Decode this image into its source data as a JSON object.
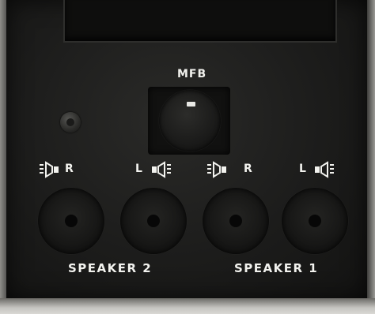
{
  "device_panel": {
    "mfb_label": "MFB",
    "speaker_groups": [
      {
        "label": "SPEAKER 2",
        "left_channel_mark": "R",
        "right_channel_mark": "L"
      },
      {
        "label": "SPEAKER 1",
        "left_channel_mark": "R",
        "right_channel_mark": "L"
      }
    ]
  },
  "icons": {
    "speaker_symbol": "speaker-icon",
    "screw": "screw-icon",
    "knob": "knob-icon",
    "jack": "speaker-jack-icon"
  },
  "colors": {
    "panel": "#1c1c1b",
    "label_text": "#f2f2ee",
    "frame": "#bdbcb8"
  }
}
